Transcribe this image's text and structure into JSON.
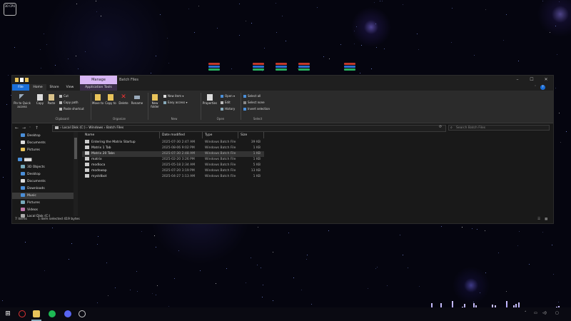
{
  "desktop": {
    "system_box_text": "30 CPU"
  },
  "window": {
    "title": "Batch Files",
    "context_tab": "Manage",
    "tabs": [
      {
        "label": "File"
      },
      {
        "label": "Home"
      },
      {
        "label": "Share"
      },
      {
        "label": "View"
      },
      {
        "label": "Application Tools"
      }
    ],
    "ribbon": {
      "pin": "Pin to Quick access",
      "copy": "Copy",
      "paste": "Paste",
      "cut": "Cut",
      "copy_path": "Copy path",
      "paste_shortcut": "Paste shortcut",
      "move_to": "Move to",
      "copy_to": "Copy to",
      "delete": "Delete",
      "rename": "Rename",
      "new_folder": "New folder",
      "new_item": "New item",
      "easy_access": "Easy access",
      "properties": "Properties",
      "open": "Open",
      "edit": "Edit",
      "history": "History",
      "select_all": "Select all",
      "select_none": "Select none",
      "invert_selection": "Invert selection",
      "groups": {
        "clipboard": "Clipboard",
        "organize": "Organize",
        "new": "New",
        "open": "Open",
        "select": "Select"
      }
    },
    "address": {
      "segments": [
        "Local Disk (C:)",
        "Windows",
        "Batch Files"
      ],
      "search_placeholder": "Search Batch Files"
    },
    "nav": {
      "items": [
        {
          "label": "Desktop"
        },
        {
          "label": "Documents"
        },
        {
          "label": "Pictures"
        },
        {
          "label": "3D Objects"
        },
        {
          "label": "Desktop"
        },
        {
          "label": "Documents"
        },
        {
          "label": "Downloads"
        },
        {
          "label": "Music"
        },
        {
          "label": "Pictures"
        },
        {
          "label": "Videos"
        },
        {
          "label": "Local Disk (C:)"
        }
      ]
    },
    "columns": {
      "name": "Name",
      "date": "Date modified",
      "type": "Type",
      "size": "Size"
    },
    "files": [
      {
        "name": "Entering the Matrix Startup",
        "date": "2025-07-30 2:47 AM",
        "type": "Windows Batch File",
        "size": "39 KB"
      },
      {
        "name": "Matrix 1 Tab",
        "date": "2025-08-06 9:02 PM",
        "type": "Windows Batch File",
        "size": "1 KB"
      },
      {
        "name": "Matrix 20 Tabs",
        "date": "2025-07-30 2:48 AM",
        "type": "Windows Batch File",
        "size": "1 KB"
      },
      {
        "name": "matrix",
        "date": "2025-02-20 3:26 PM",
        "type": "Windows Batch File",
        "size": "1 KB"
      },
      {
        "name": "modloca",
        "date": "2025-05-18 2:34 AM",
        "type": "Windows Batch File",
        "size": "5 KB"
      },
      {
        "name": "modswap",
        "date": "2025-07-20 3:19 PM",
        "type": "Windows Batch File",
        "size": "13 KB"
      },
      {
        "name": "mystdbot",
        "date": "2025-04-27 1:13 AM",
        "type": "Windows Batch File",
        "size": "1 KB"
      }
    ],
    "status": {
      "items": "7 items",
      "selected": "1 item selected 419 bytes"
    }
  },
  "colors": {
    "accent": "#1a6ed8",
    "manage_tab": "#d8b6f5"
  }
}
